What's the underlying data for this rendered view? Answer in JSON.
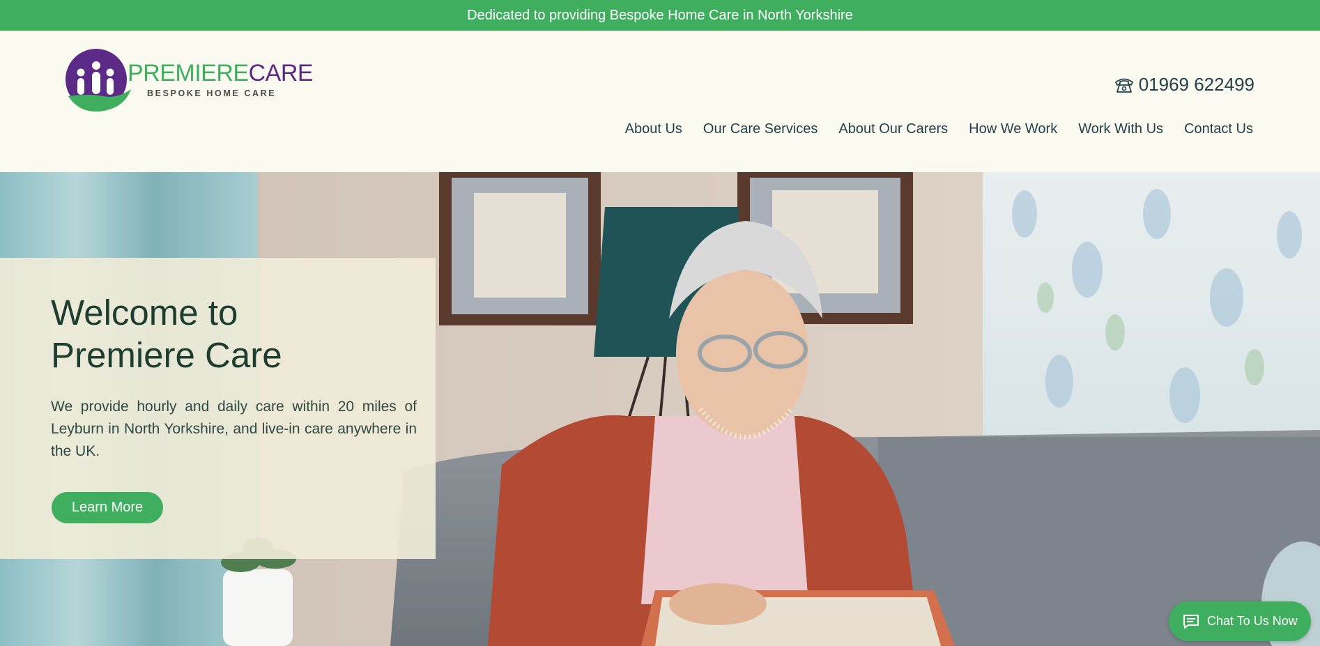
{
  "topbar": {
    "text": "Dedicated to providing Bespoke Home Care in North Yorkshire"
  },
  "logo": {
    "word1": "PREMIERE",
    "word2": "CARE",
    "tagline": "BESPOKE HOME CARE"
  },
  "header": {
    "phone": "01969 622499",
    "phone_icon": "telephone-icon"
  },
  "nav": {
    "items": [
      {
        "label": "About Us"
      },
      {
        "label": "Our Care Services"
      },
      {
        "label": "About Our Carers"
      },
      {
        "label": "How We Work"
      },
      {
        "label": "Work With Us"
      },
      {
        "label": "Contact Us"
      }
    ]
  },
  "hero": {
    "title_line1": "Welcome to",
    "title_line2": "Premiere Care",
    "text": "We provide hourly and daily care within 20 miles of Leyburn in North Yorkshire, and live-in care anywhere in the UK.",
    "button_label": "Learn More"
  },
  "chat": {
    "label": "Chat To Us Now",
    "icon": "chat-bubble-icon"
  },
  "colors": {
    "brand_green": "#3fae5e",
    "brand_purple": "#5b2a86",
    "header_bg": "#fbfaf1",
    "text_dark": "#24414a"
  }
}
